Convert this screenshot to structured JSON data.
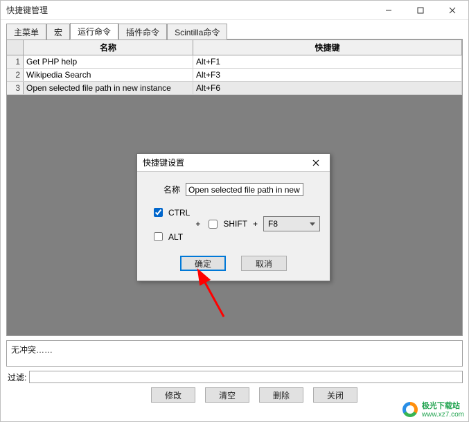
{
  "window": {
    "title": "快捷键管理"
  },
  "tabs": {
    "items": [
      "主菜单",
      "宏",
      "运行命令",
      "插件命令",
      "Scintilla命令"
    ],
    "active_index": 2
  },
  "table": {
    "head": {
      "name": "名称",
      "key": "快捷键"
    },
    "rows": [
      {
        "num": "1",
        "name": "Get PHP help",
        "key": "Alt+F1",
        "selected": false
      },
      {
        "num": "2",
        "name": "Wikipedia Search",
        "key": "Alt+F3",
        "selected": false
      },
      {
        "num": "3",
        "name": "Open selected file path in new instance",
        "key": "Alt+F6",
        "selected": true
      }
    ]
  },
  "status": {
    "text": "无冲突……"
  },
  "filter": {
    "label": "过滤:",
    "value": ""
  },
  "buttons": {
    "modify": "修改",
    "clear": "清空",
    "delete": "删除",
    "close": "关闭"
  },
  "dialog": {
    "title": "快捷键设置",
    "name_label": "名称",
    "name_value": "Open selected file path in new insta",
    "ctrl_label": "CTRL",
    "ctrl_checked": true,
    "shift_label": "SHIFT",
    "shift_checked": false,
    "alt_label": "ALT",
    "alt_checked": false,
    "plus": "+",
    "key_value": "F8",
    "ok": "确定",
    "cancel": "取消"
  },
  "watermark": {
    "line1": "极光下载站",
    "line2": "www.xz7.com"
  }
}
